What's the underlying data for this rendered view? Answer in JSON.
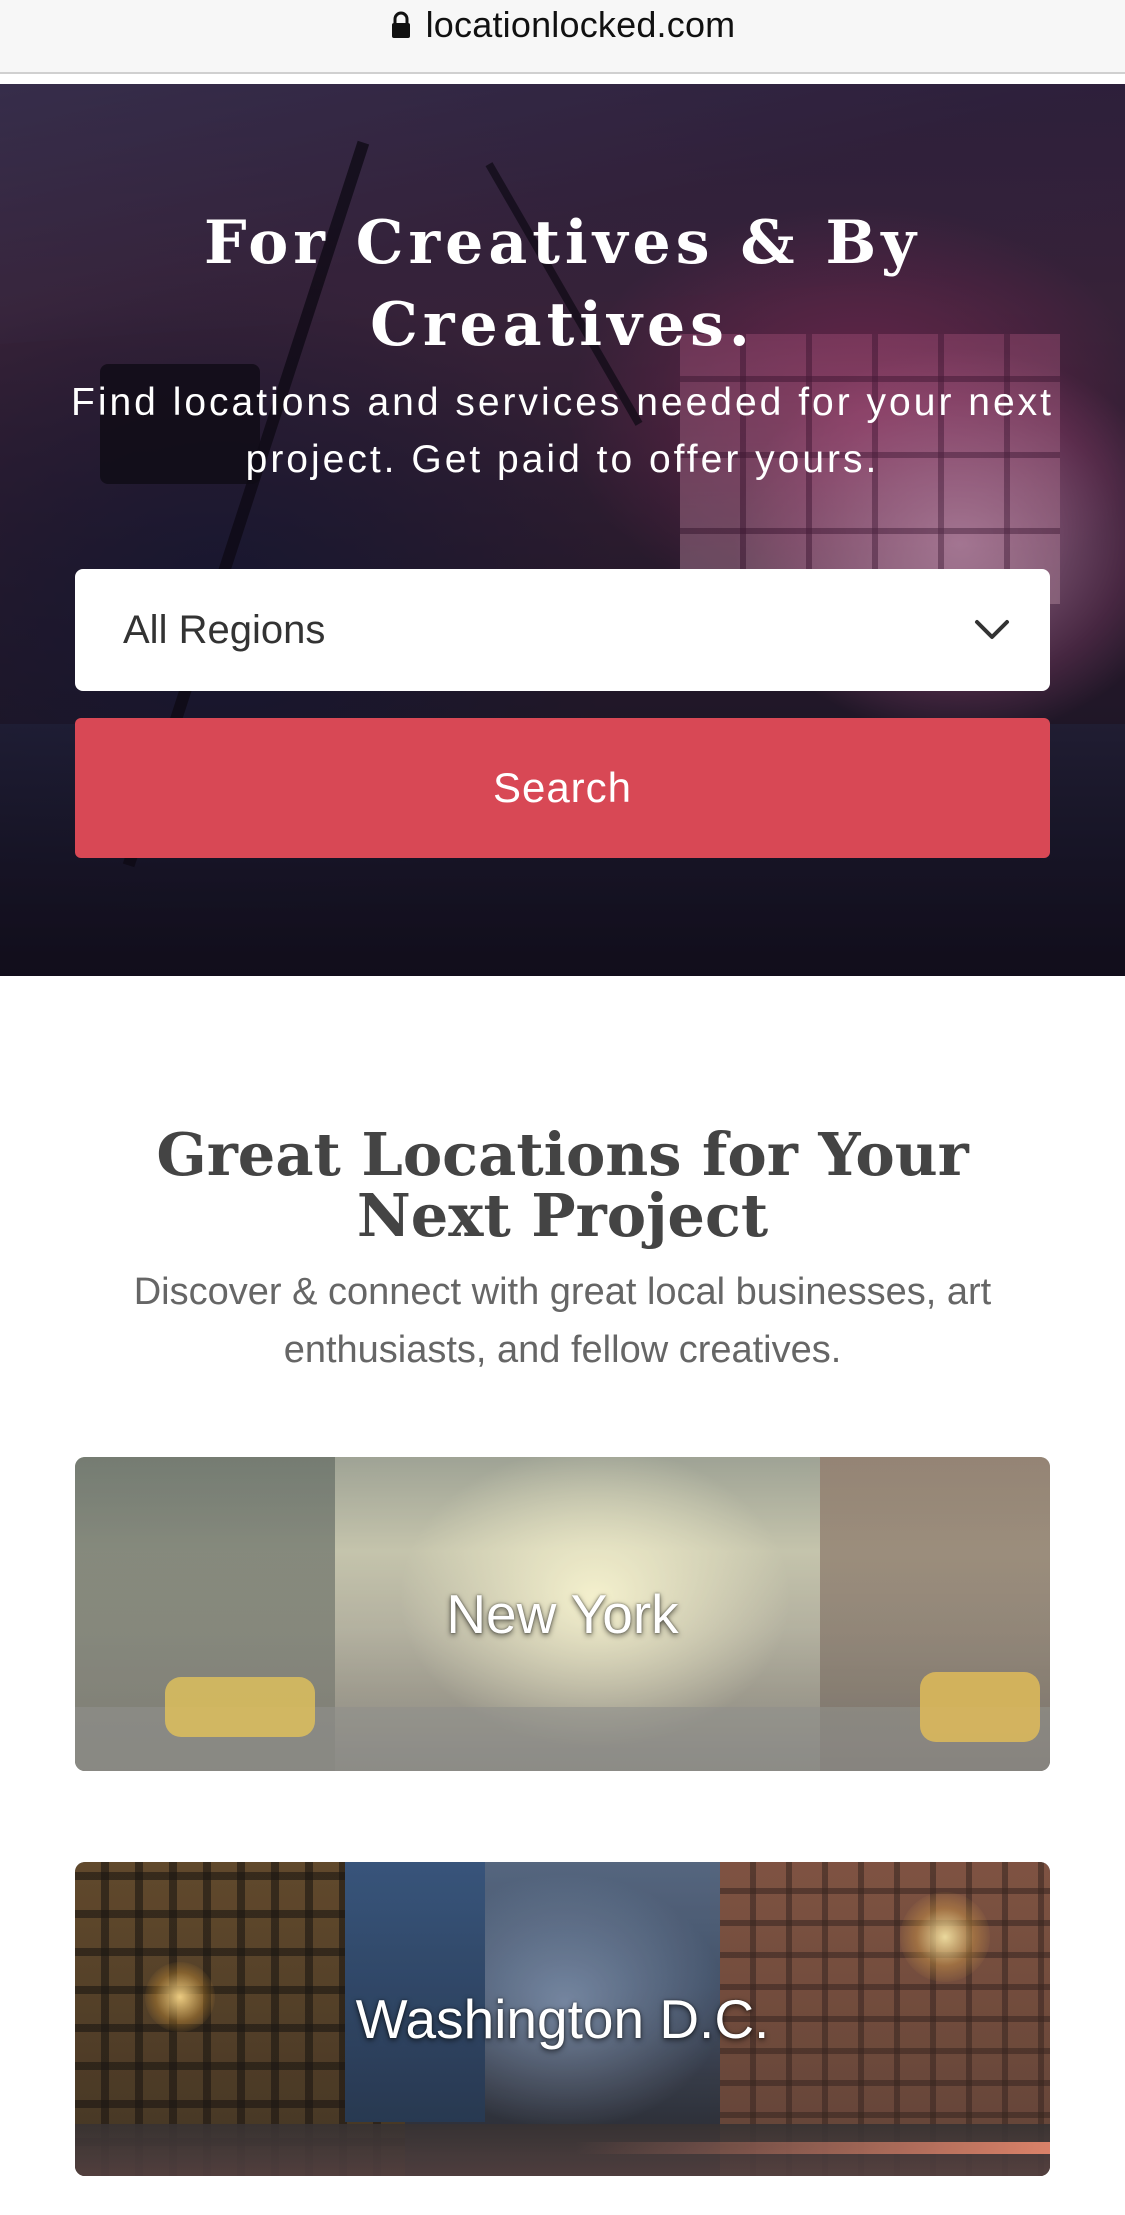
{
  "browser": {
    "url": "locationlocked.com"
  },
  "hero": {
    "title": "For Creatives & By Creatives.",
    "subtitle": "Find locations and services needed for your next project. Get paid to offer yours.",
    "region_select": {
      "selected": "All Regions"
    },
    "search_button": "Search"
  },
  "locations_section": {
    "title": "Great Locations for Your Next Project",
    "subtitle": "Discover & connect with great local businesses, art enthusiasts, and fellow creatives.",
    "cards": [
      {
        "label": "New York"
      },
      {
        "label": "Washington D.C."
      }
    ]
  },
  "colors": {
    "accent": "#d84855",
    "heading_text": "#444444",
    "body_text": "#666666"
  }
}
